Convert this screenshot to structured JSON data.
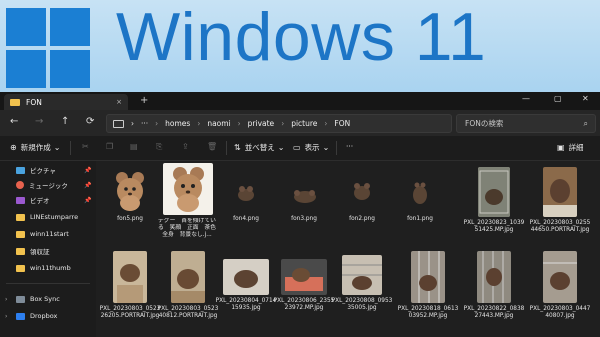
{
  "banner": {
    "brand_text": "Windows 11",
    "brand_color": "#1d75c6",
    "background": "#b9dbf3"
  },
  "window": {
    "tab_title": "FON",
    "tab_close": "×",
    "new_tab": "+",
    "controls": {
      "minimize": "—",
      "maximize": "▢",
      "close": "✕"
    }
  },
  "nav": {
    "back": "←",
    "forward": "→",
    "up": "↑",
    "refresh": "⟳"
  },
  "address": {
    "more": "···",
    "path": [
      "homes",
      "naomi",
      "private",
      "picture",
      "FON"
    ],
    "separator": "›"
  },
  "search": {
    "placeholder": "FONの検索",
    "icon": "search-icon"
  },
  "toolbar": {
    "new_label": "新規作成",
    "sort_label": "並べ替え",
    "view_label": "表示",
    "more": "···",
    "details_label": "詳細"
  },
  "sidebar": {
    "items": [
      {
        "label": "ピクチャ",
        "icon": "pictures-icon",
        "pinned": true
      },
      {
        "label": "ミュージック",
        "icon": "music-icon",
        "pinned": true
      },
      {
        "label": "ビデオ",
        "icon": "video-icon",
        "pinned": true
      },
      {
        "label": "LINEstumparre",
        "icon": "folder-icon",
        "pinned": false
      },
      {
        "label": "winn11start",
        "icon": "folder-icon",
        "pinned": false
      },
      {
        "label": "領収証",
        "icon": "folder-icon",
        "pinned": false
      },
      {
        "label": "win11thumb",
        "icon": "folder-icon",
        "pinned": false
      },
      {
        "label": "Box Sync",
        "icon": "box-icon",
        "pinned": false
      },
      {
        "label": "Dropbox",
        "icon": "dropbox-icon",
        "pinned": false
      }
    ]
  },
  "files": [
    {
      "name": "fon5.png",
      "kind": "mouse-cartoon"
    },
    {
      "name": "デグー　首を傾げている　笑顔　正面　茶色　全身　背景なし.j...",
      "kind": "mouse-cartoon-doc"
    },
    {
      "name": "fon4.png",
      "kind": "mouse-small"
    },
    {
      "name": "fon3.png",
      "kind": "mouse-small"
    },
    {
      "name": "fon2.png",
      "kind": "mouse-small"
    },
    {
      "name": "fon1.png",
      "kind": "mouse-small"
    },
    {
      "name": "PXL_20230823_103951425.MP.jpg",
      "kind": "photo"
    },
    {
      "name": "PXL_20230803_025544650.PORTRAIT.jpg",
      "kind": "photo"
    },
    {
      "name": "PXL_20230803_052326205.PORTRAIT.jpg",
      "kind": "photo"
    },
    {
      "name": "PXL_20230803_052340812.PORTRAIT.jpg",
      "kind": "photo"
    },
    {
      "name": "PXL_20230804_071415935.jpg",
      "kind": "photo"
    },
    {
      "name": "PXL_20230806_235523972.MP.jpg",
      "kind": "photo"
    },
    {
      "name": "PXL_20230808_095335005.jpg",
      "kind": "photo"
    },
    {
      "name": "PXL_20230818_061303952.MP.jpg",
      "kind": "photo"
    },
    {
      "name": "PXL_20230822_083827443.MP.jpg",
      "kind": "photo"
    },
    {
      "name": "PXL_20230803_044740807.jpg",
      "kind": "photo"
    }
  ]
}
